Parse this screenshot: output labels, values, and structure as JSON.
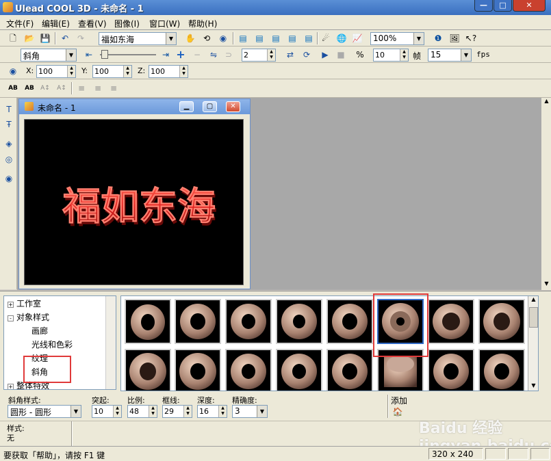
{
  "window": {
    "title": "Ulead COOL 3D - 未命名 - 1",
    "min_glyph": "—",
    "max_glyph": "□",
    "close_glyph": "✕"
  },
  "menu": [
    "文件(F)",
    "编辑(E)",
    "查看(V)",
    "图像(I)",
    "窗口(W)",
    "帮助(H)"
  ],
  "toolbar1": {
    "text_combo": "福如东海",
    "zoom_combo": "100%"
  },
  "toolbar2": {
    "object_combo": "斜角",
    "frame_value": "2",
    "fps_frames_value": "10",
    "frame_label": "帧",
    "fps_combo": "15",
    "fps_label": "fps"
  },
  "toolbar3": {
    "x_label": "X:",
    "x_value": "100",
    "y_label": "Y:",
    "y_value": "100",
    "z_label": "Z:",
    "z_value": "100"
  },
  "doc_window": {
    "title": "未命名 - 1",
    "text": "福如东海"
  },
  "tree": {
    "items": [
      {
        "label": "工作室",
        "expander": "+"
      },
      {
        "label": "对象样式",
        "expander": "-"
      },
      {
        "label": "画廊"
      },
      {
        "label": "光线和色彩"
      },
      {
        "label": "纹理"
      },
      {
        "label": "斜角"
      },
      {
        "label": "整体特效",
        "expander": "+"
      }
    ]
  },
  "properties": {
    "bevel_style_label": "斜角样式:",
    "bevel_style_value": "圆形 - 圆形",
    "protrude_label": "突起:",
    "protrude_value": "10",
    "scale_label": "比例:",
    "scale_value": "48",
    "border_label": "框线:",
    "border_value": "29",
    "depth_label": "深度:",
    "depth_value": "16",
    "precision_label": "精确度:",
    "precision_value": "3",
    "add_label": "添加"
  },
  "style_area": {
    "label": "样式:",
    "value": "无"
  },
  "status": {
    "help_text": "要获取「帮助」，请按 F1 键",
    "canvas_size": "320 x 240"
  },
  "watermark": "Baidu 经验 jingyan.baidu.com",
  "colors": {
    "title_blue": "#3a6fbf",
    "text_red": "#e0201e",
    "highlight_red": "#e03a3a",
    "selection_blue": "#316ac5"
  }
}
